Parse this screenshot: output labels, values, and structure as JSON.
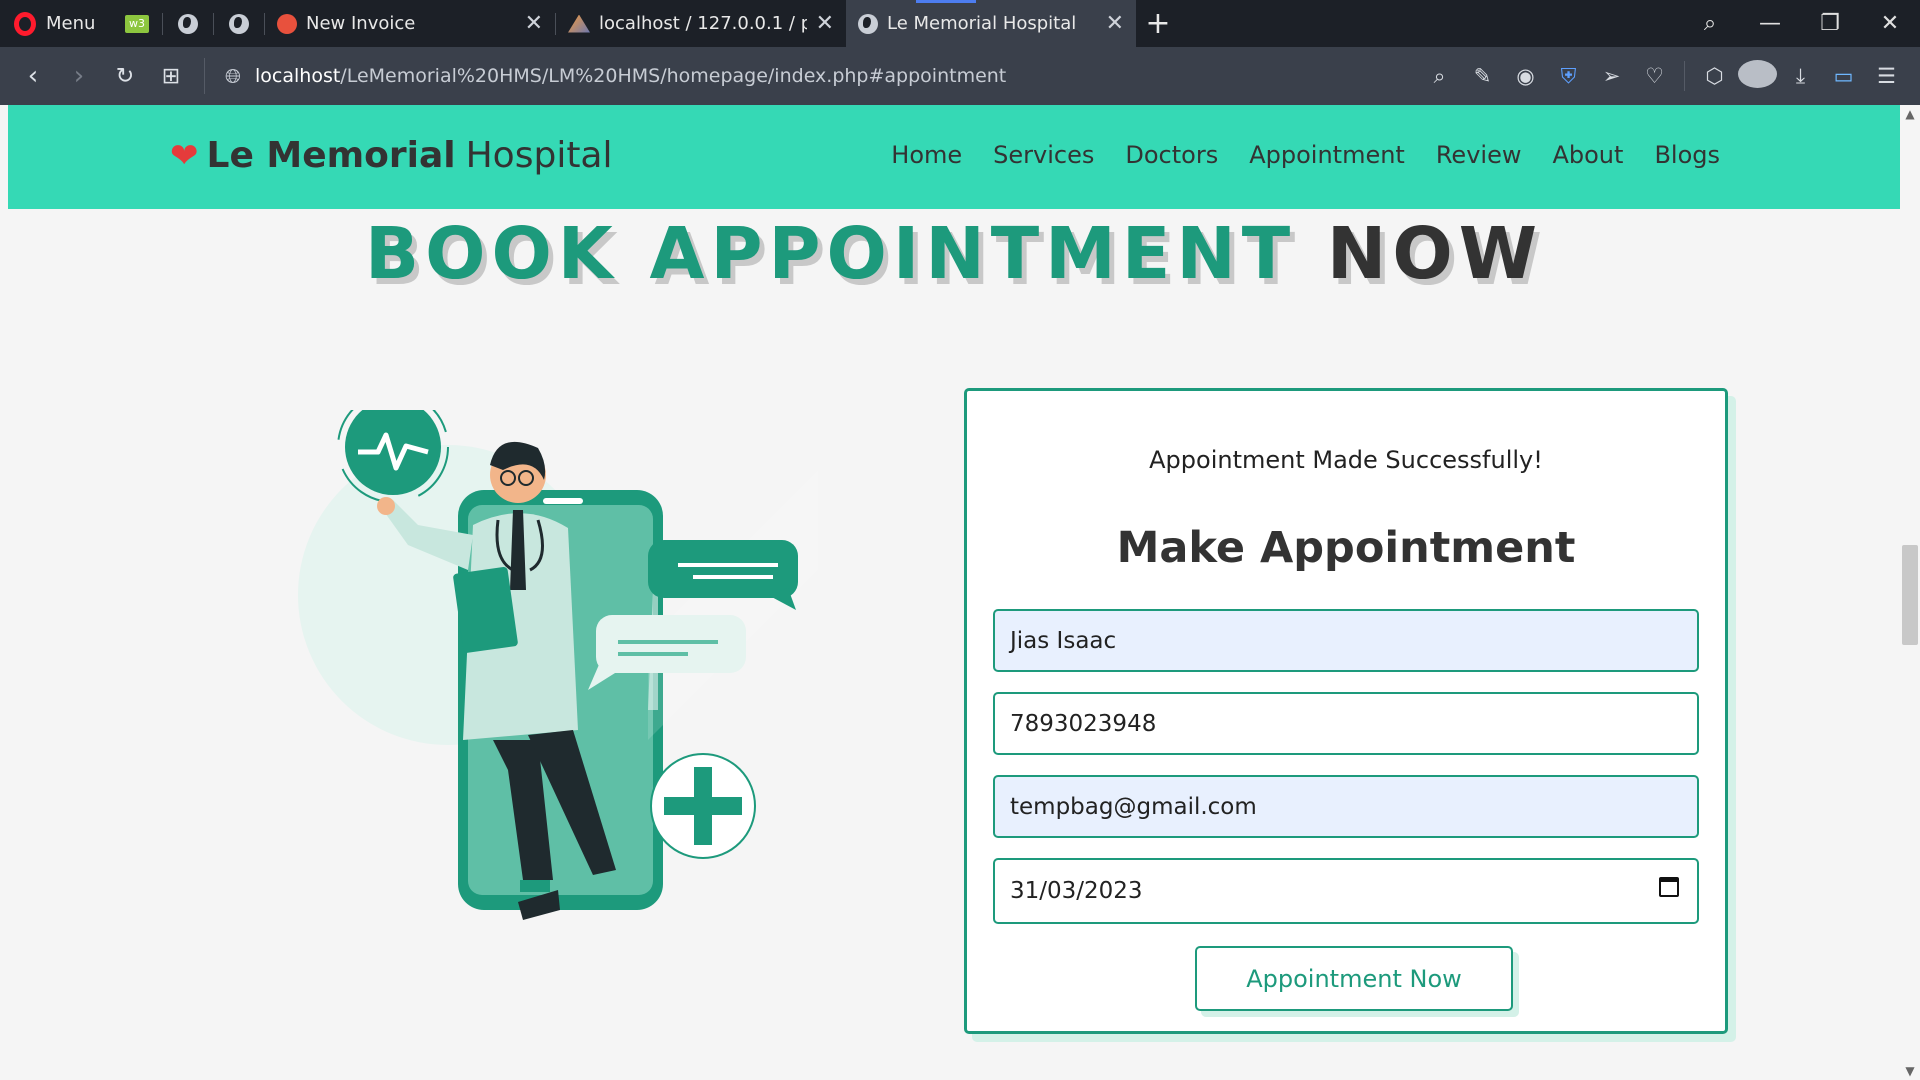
{
  "browser": {
    "menu_label": "Menu",
    "tabs": [
      {
        "title": "New Invoice",
        "active": false
      },
      {
        "title": "localhost / 127.0.0.1 / pharr",
        "active": false
      },
      {
        "title": "Le Memorial Hospital",
        "active": true
      }
    ],
    "url_host": "localhost",
    "url_path": "/LeMemorial%20HMS/LM%20HMS/homepage/index.php#appointment"
  },
  "site": {
    "logo_bold": "Le Memorial",
    "logo_light": "Hospital",
    "nav": [
      "Home",
      "Services",
      "Doctors",
      "Appointment",
      "Review",
      "About",
      "Blogs"
    ],
    "section_title_1": "BOOK APPOINTMENT",
    "section_title_2": "NOW"
  },
  "form": {
    "success_message": "Appointment Made Successfully!",
    "heading": "Make Appointment",
    "name_value": "Jias Isaac",
    "phone_value": "7893023948",
    "email_value": "tempbag@gmail.com",
    "date_value": "31/03/2023",
    "submit_label": "Appointment Now"
  },
  "colors": {
    "header_bg": "#35d9b5",
    "accent": "#1d9a7c",
    "heart": "#e53b3b"
  }
}
